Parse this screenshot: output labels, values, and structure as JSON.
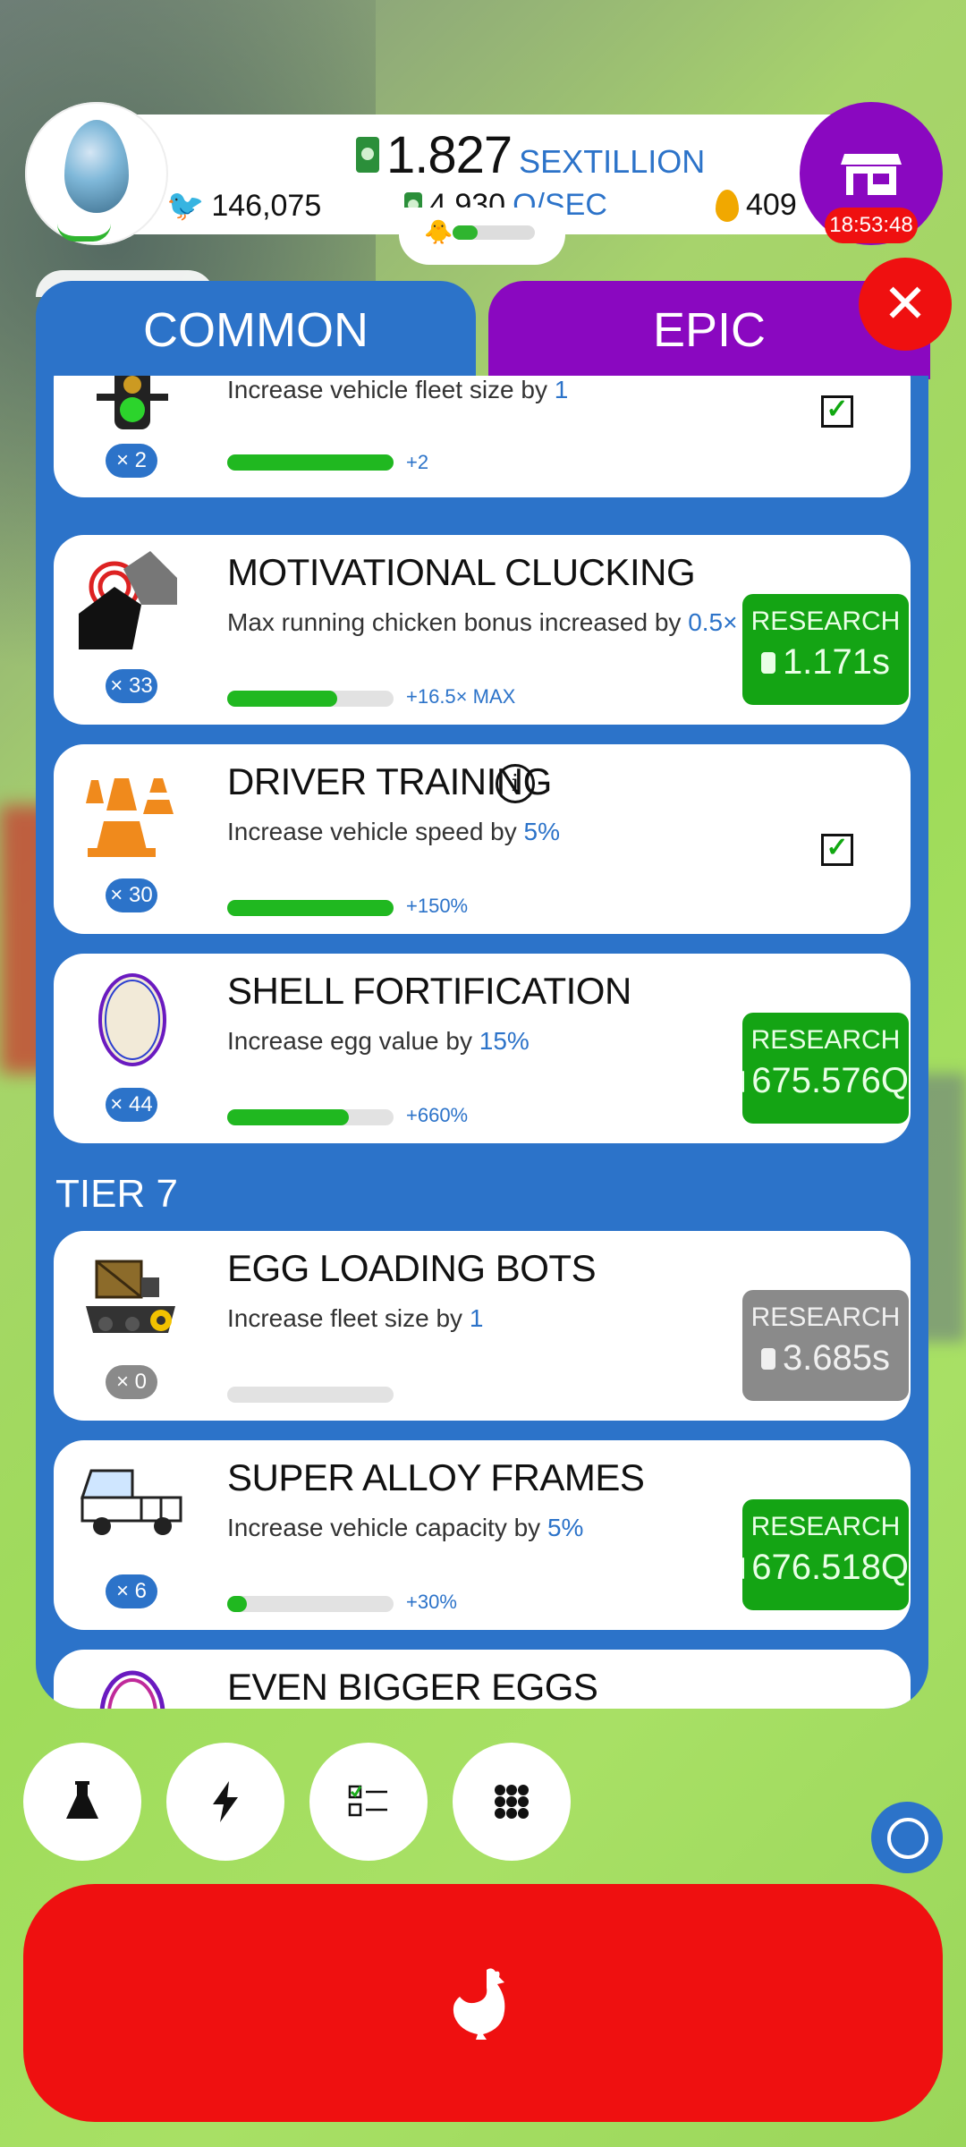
{
  "hud": {
    "money_amount": "1.827",
    "money_unit": "SEXTILLION",
    "chickens": "146,075",
    "rate_amount": "4.930",
    "rate_unit": "Q/SEC",
    "golden_eggs": "409",
    "timer": "18:53:48",
    "hatch_progress": 0.3
  },
  "tabs": {
    "common": "COMMON",
    "epic": "EPIC"
  },
  "close_label": "✕",
  "research_label": "RESEARCH",
  "items": [
    {
      "id": "fleet",
      "title": "",
      "desc_prefix": "Increase vehicle fleet size by ",
      "desc_value": "1",
      "count": "× 2",
      "bonus": "+2",
      "progress": 1.0,
      "state": "complete",
      "icon": "traffic-light-icon"
    },
    {
      "id": "motivational",
      "title": "MOTIVATIONAL CLUCKING",
      "desc_prefix": "Max running chicken bonus increased by ",
      "desc_value": "0.5×",
      "count": "× 33",
      "bonus": "+16.5× MAX",
      "progress": 0.66,
      "state": "available",
      "cost": "1.171s",
      "icon": "chicken-megaphone-icon"
    },
    {
      "id": "driver",
      "title": "DRIVER TRAINING",
      "desc_prefix": "Increase vehicle speed by ",
      "desc_value": "5%",
      "count": "× 30",
      "bonus": "+150%",
      "progress": 1.0,
      "state": "complete",
      "info": "i",
      "icon": "traffic-cones-icon"
    },
    {
      "id": "shell",
      "title": "SHELL FORTIFICATION",
      "desc_prefix": "Increase egg value by ",
      "desc_value": "15%",
      "count": "× 44",
      "bonus": "+660%",
      "progress": 0.73,
      "state": "available",
      "cost": "675.576Q",
      "icon": "egg-icon"
    },
    {
      "id": "bots",
      "title": "EGG LOADING BOTS",
      "desc_prefix": "Increase fleet size by ",
      "desc_value": "1",
      "count": "× 0",
      "bonus": "",
      "progress": 0.0,
      "state": "locked",
      "cost": "3.685s",
      "icon": "robot-tank-icon"
    },
    {
      "id": "alloy",
      "title": "SUPER ALLOY FRAMES",
      "desc_prefix": "Increase vehicle capacity by ",
      "desc_value": "5%",
      "count": "× 6",
      "bonus": "+30%",
      "progress": 0.12,
      "state": "available",
      "cost": "676.518Q",
      "icon": "truck-icon"
    },
    {
      "id": "bigger",
      "title": "EVEN BIGGER EGGS",
      "icon": "rainbow-egg-icon"
    }
  ],
  "tier_label": "TIER 7",
  "bottom_icons": [
    "flask-icon",
    "bolt-icon",
    "checklist-icon",
    "grid-icon"
  ],
  "colors": {
    "panel_blue": "#2c73c9",
    "epic_purple": "#8a08c0",
    "research_green": "#14a414",
    "hatch_red": "#ef1010"
  }
}
